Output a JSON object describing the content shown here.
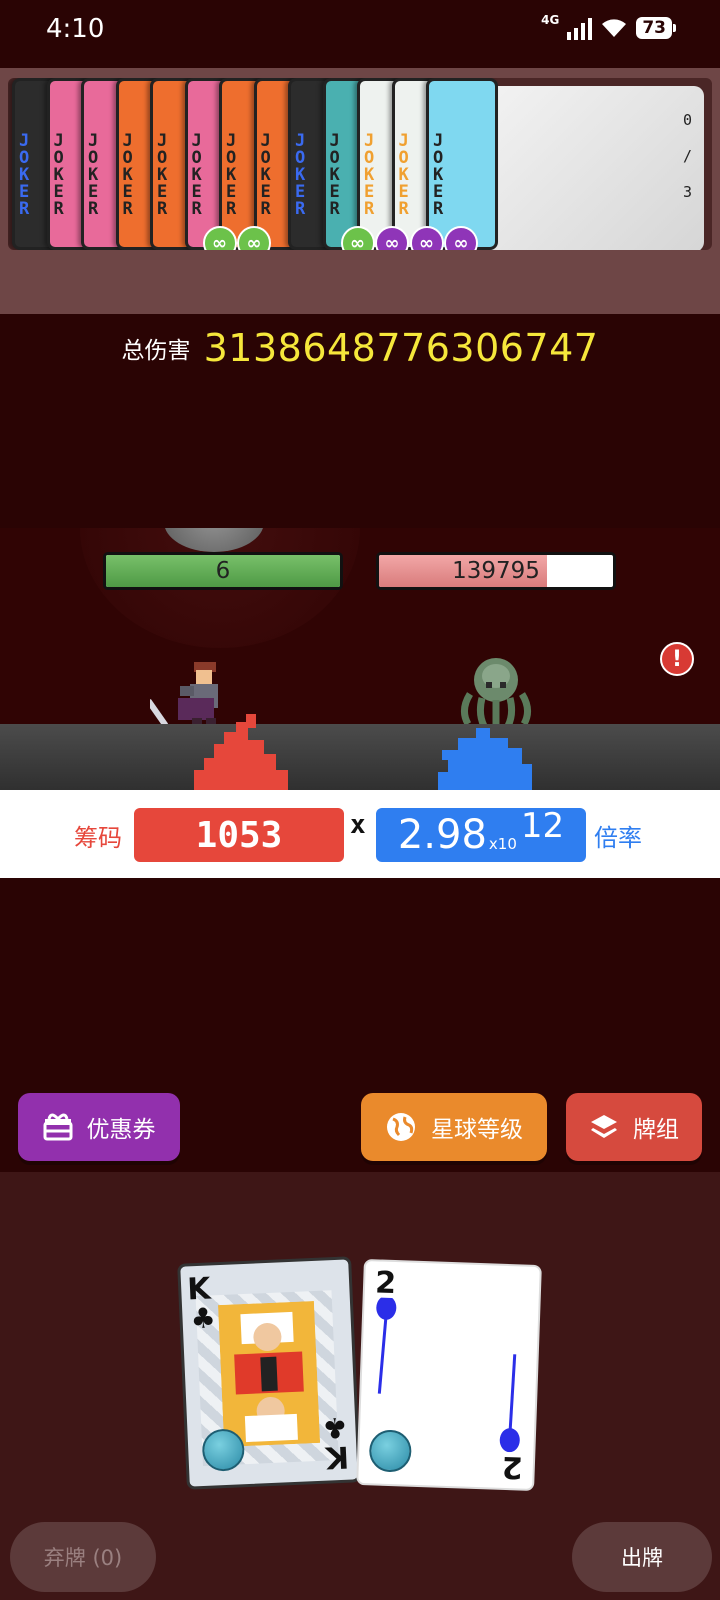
{
  "status_bar": {
    "time": "4:10",
    "network": "4G",
    "battery": "73"
  },
  "jokers": [
    {
      "label": "JOKER",
      "color": "#2c2c2c",
      "text_color": "#3a6af0",
      "badge": ""
    },
    {
      "label": "JOKER",
      "color": "#e86a9a",
      "text_color": "#222222",
      "badge": ""
    },
    {
      "label": "JOKER",
      "color": "#e86a9a",
      "text_color": "#222222",
      "badge": ""
    },
    {
      "label": "JOKER",
      "color": "#ee6e2e",
      "text_color": "#222222",
      "badge": ""
    },
    {
      "label": "JOKER",
      "color": "#ee6e2e",
      "text_color": "#222222",
      "badge": ""
    },
    {
      "label": "JOKER",
      "color": "#e86a9a",
      "text_color": "#222222",
      "badge": "∞"
    },
    {
      "label": "JOKER",
      "color": "#ee6e2e",
      "text_color": "#222222",
      "badge": "∞"
    },
    {
      "label": "JOKER",
      "color": "#ee6e2e",
      "text_color": "#222222",
      "badge": ""
    },
    {
      "label": "JOKER",
      "color": "#2c2c2c",
      "text_color": "#3a6af0",
      "badge": ""
    },
    {
      "label": "JOKER",
      "color": "#4ab0b0",
      "text_color": "#222222",
      "badge": "∞"
    },
    {
      "label": "JOKER",
      "color": "#eef2ef",
      "text_color": "#f0a030",
      "badge": "∞"
    },
    {
      "label": "JOKER",
      "color": "#eef2ef",
      "text_color": "#f0a030",
      "badge": "∞"
    },
    {
      "label": "JOKER",
      "color": "#7fd8f0",
      "text_color": "#222222",
      "badge": "∞"
    }
  ],
  "joker_slots": {
    "current": "0",
    "sep": "/",
    "max": "3"
  },
  "total_damage": {
    "label": "总伤害",
    "value": "31386487763067​47"
  },
  "battle": {
    "player_hp": "6",
    "player_hp_fraction": 1.0,
    "enemy_hp": "139795",
    "enemy_hp_fraction": 0.72,
    "alert": "!"
  },
  "score": {
    "chips_label": "筹码",
    "chips_value": "1053",
    "times": "x",
    "mult_mantissa": "2.98",
    "mult_base": "x10",
    "mult_exponent": "12",
    "mult_label": "倍率"
  },
  "buttons": {
    "coupon": "优惠券",
    "planet_level": "星球等级",
    "deck": "牌组",
    "discard": "弃牌 (0)",
    "play": "出牌"
  },
  "hand": [
    {
      "rank": "K",
      "suit": "♣"
    },
    {
      "rank": "2",
      "suit": ""
    }
  ],
  "colors": {
    "chips": "#e6473b",
    "mult": "#2f7ef0",
    "damage_text": "#f6e73b",
    "infinity_green": "#6cc24a",
    "infinity_purple": "#8f35b8"
  }
}
